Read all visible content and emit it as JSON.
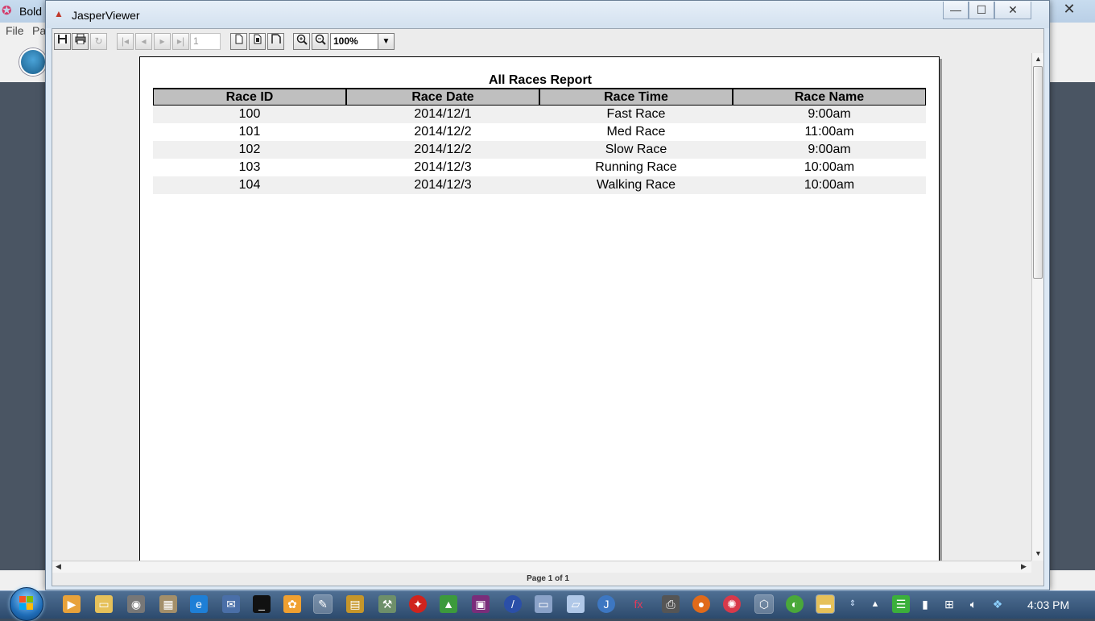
{
  "background_app": {
    "title": "Bold",
    "menu": [
      "File",
      "Pa"
    ]
  },
  "window": {
    "title": "JasperViewer",
    "controls": {
      "minimize": "—",
      "maximize": "☐",
      "close": "✕"
    }
  },
  "toolbar": {
    "page_input": "1",
    "zoom": "100%"
  },
  "report": {
    "title": "All Races Report",
    "columns": [
      "Race ID",
      "Race Date",
      "Race Time",
      "Race Name"
    ],
    "rows": [
      [
        "100",
        "2014/12/1",
        "Fast Race",
        "9:00am"
      ],
      [
        "101",
        "2014/12/2",
        "Med Race",
        "11:00am"
      ],
      [
        "102",
        "2014/12/2",
        "Slow Race",
        "9:00am"
      ],
      [
        "103",
        "2014/12/3",
        "Running Race",
        "10:00am"
      ],
      [
        "104",
        "2014/12/3",
        "Walking Race",
        "10:00am"
      ]
    ]
  },
  "status": {
    "page_label": "Page 1 of 1"
  },
  "taskbar": {
    "clock": "4:03 PM"
  },
  "colors": {
    "header_bg": "#bfbfbf",
    "alt_row_bg": "#f0f0f0",
    "taskbar": "#3b5a80"
  }
}
